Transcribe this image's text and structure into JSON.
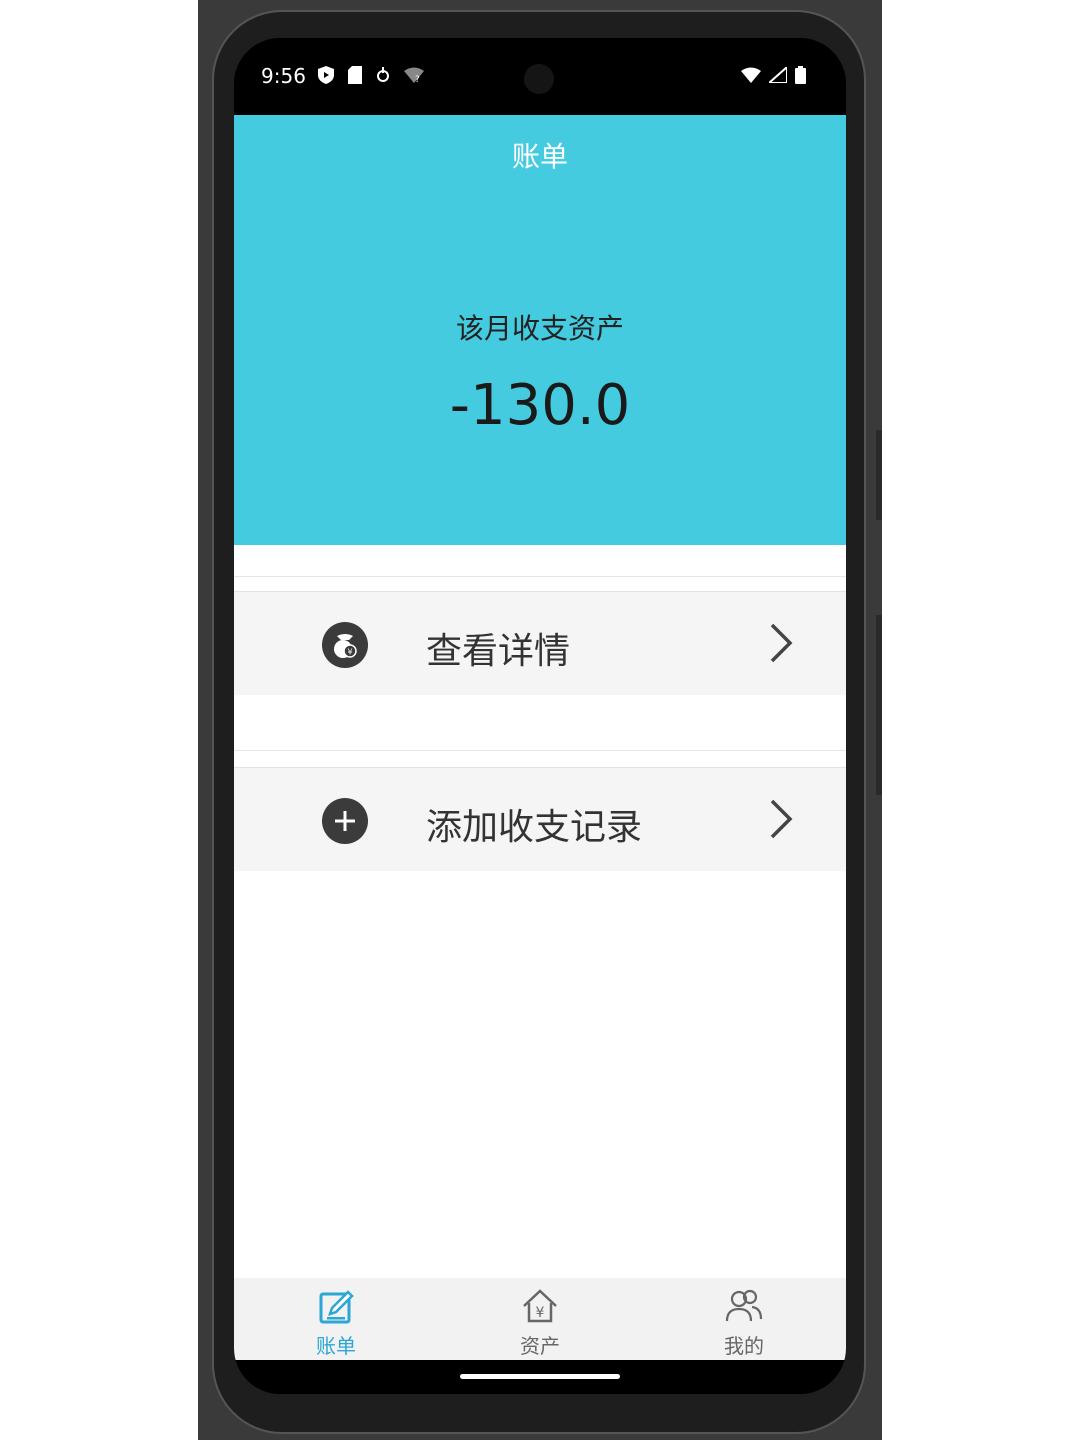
{
  "status_bar": {
    "time": "9:56"
  },
  "header": {
    "title": "账单",
    "summary_label": "该月收支资产",
    "summary_amount": "-130.0"
  },
  "menu": {
    "items": [
      {
        "label": "查看详情",
        "icon": "money-bag-icon"
      },
      {
        "label": "添加收支记录",
        "icon": "plus-circle-icon"
      }
    ]
  },
  "tabbar": {
    "tabs": [
      {
        "label": "账单",
        "icon": "edit-note-icon",
        "active": true
      },
      {
        "label": "资产",
        "icon": "house-yen-icon",
        "active": false
      },
      {
        "label": "我的",
        "icon": "users-icon",
        "active": false
      }
    ]
  },
  "colors": {
    "header_bg": "#44cbdf",
    "active_tab": "#2aa7d4",
    "row_bg": "#f5f5f5"
  }
}
